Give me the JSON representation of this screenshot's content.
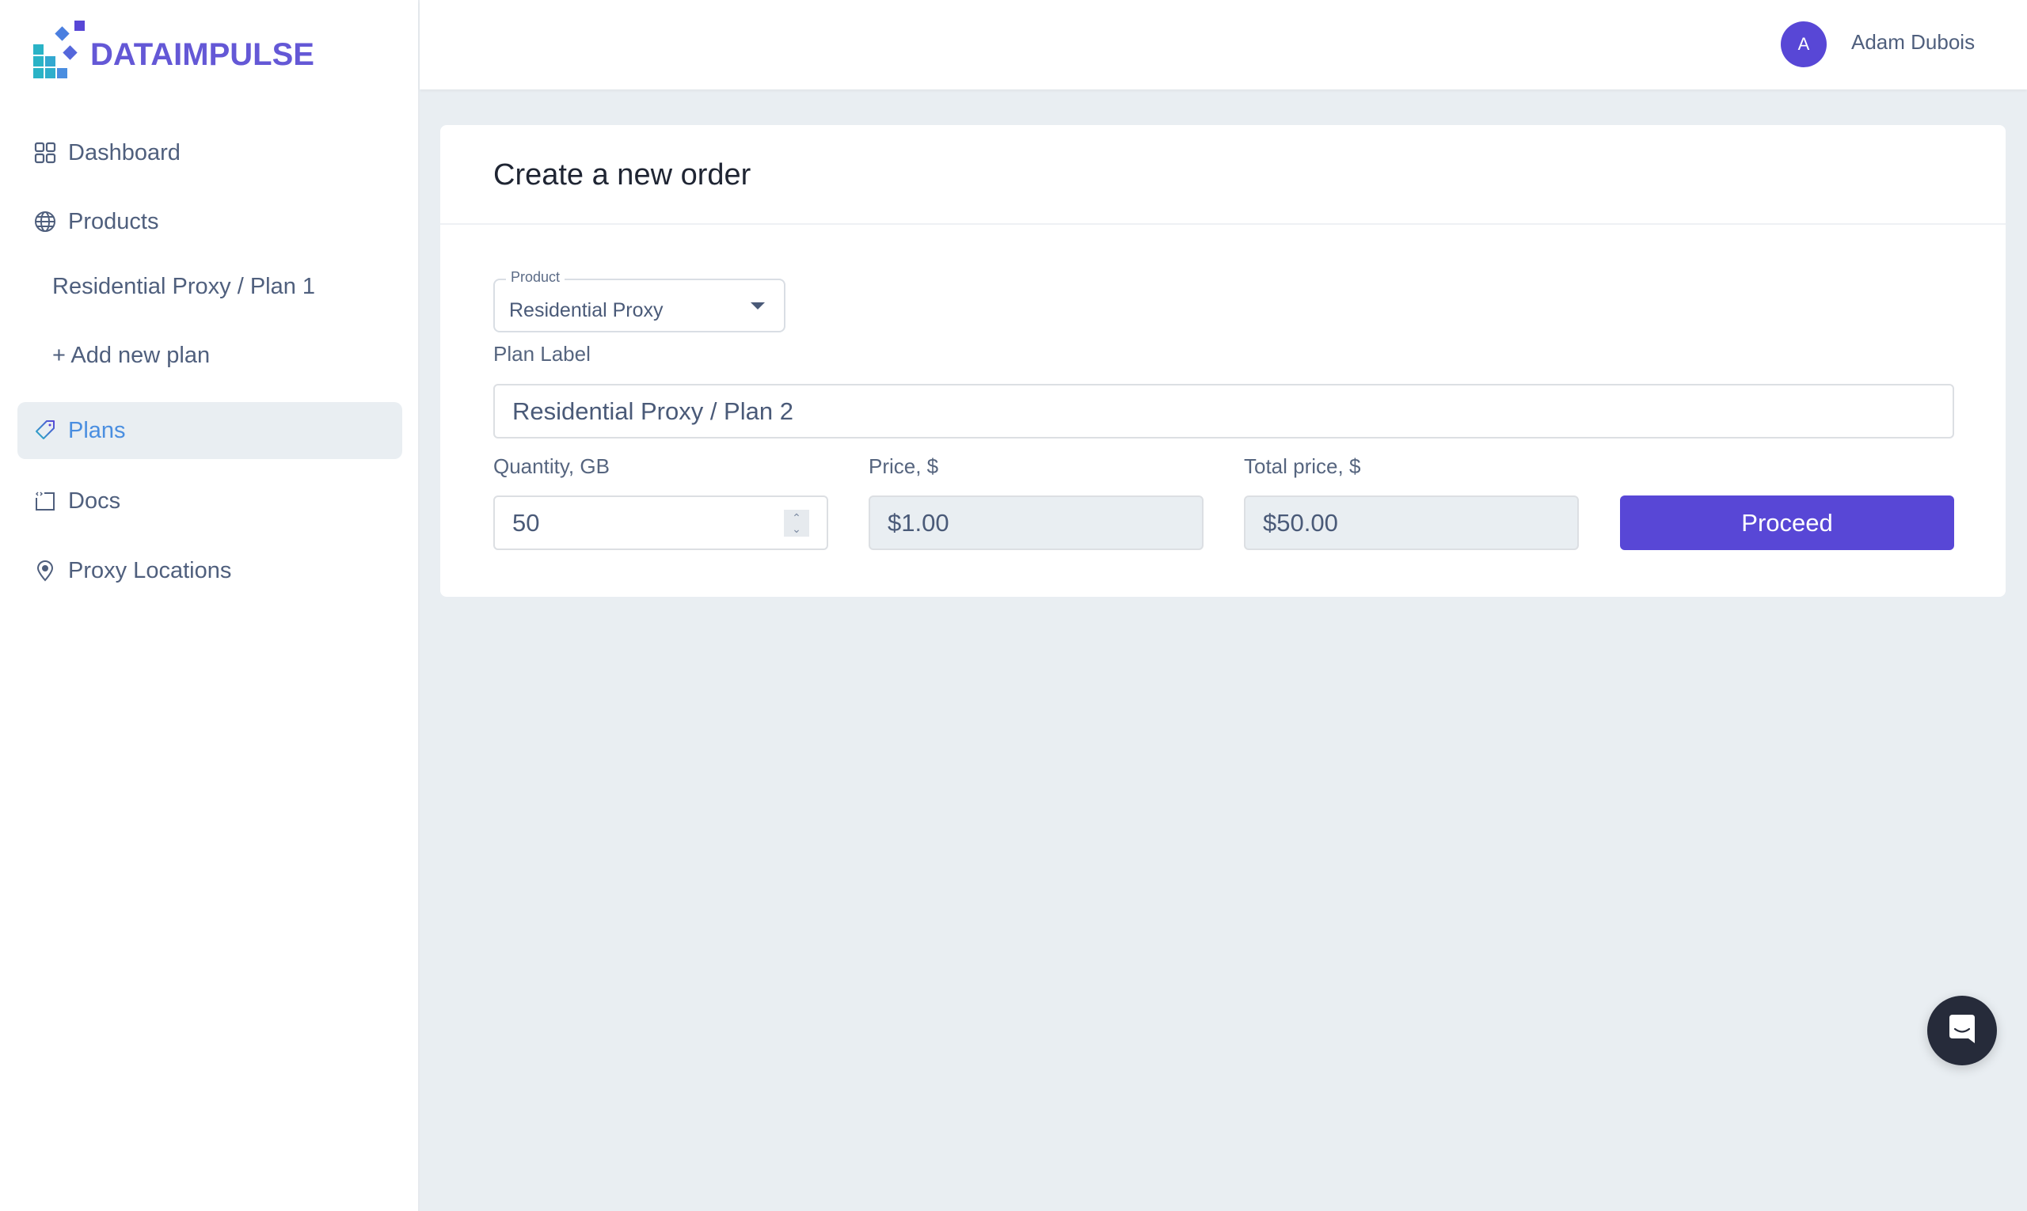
{
  "brand": {
    "name": "DATAIMPULSE",
    "colors": {
      "primary": "#5847d6",
      "teal": "#2ab3c6",
      "blue": "#4a8ee0"
    }
  },
  "sidebar": {
    "items": [
      {
        "label": "Dashboard",
        "icon": "dashboard-grid-icon"
      },
      {
        "label": "Products",
        "icon": "globe-icon"
      },
      {
        "label": "Residential Proxy / Plan 1",
        "icon": null
      },
      {
        "label": "+ Add new plan",
        "icon": null
      },
      {
        "label": "Plans",
        "icon": "tag-icon",
        "active": true
      },
      {
        "label": "Docs",
        "icon": "code-doc-icon"
      },
      {
        "label": "Proxy Locations",
        "icon": "map-pin-icon"
      }
    ]
  },
  "header": {
    "user": {
      "initial": "A",
      "name": "Adam Dubois"
    }
  },
  "order": {
    "title": "Create a new order",
    "product": {
      "legend": "Product",
      "value": "Residential Proxy"
    },
    "plan_label": {
      "label": "Plan Label",
      "value": "Residential Proxy / Plan 2"
    },
    "quantity": {
      "label": "Quantity, GB",
      "value": "50"
    },
    "price": {
      "label": "Price, $",
      "value": "$1.00"
    },
    "total": {
      "label": "Total price, $",
      "value": "$50.00"
    },
    "proceed_label": "Proceed"
  },
  "chat": {
    "icon": "chat-bubble-icon"
  }
}
